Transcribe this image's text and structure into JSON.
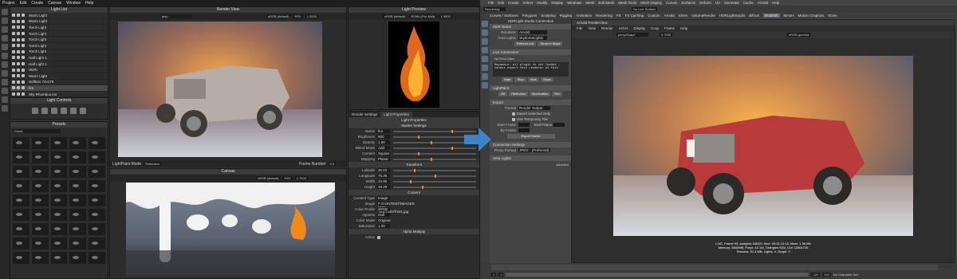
{
  "left": {
    "menu": [
      "Project",
      "Edit",
      "Create",
      "Canvas",
      "Window",
      "Help"
    ],
    "light_list": {
      "title": "Light List",
      "items": [
        "Warm Light",
        "Warm Light",
        "Torch Light",
        "Torch Light",
        "Torch Light",
        "Torch Light",
        "Torch Light",
        "Half Light 1",
        "Half Light 1",
        "HDRi",
        "Warm Light",
        "Softbox 72x175",
        "fire",
        "Sky Rhombus.exr"
      ],
      "selected": 12
    },
    "light_controls": {
      "title": "Light Controls"
    },
    "presets": {
      "title": "Presets",
      "filter": "Cloud"
    },
    "render_view": {
      "title": "Render View",
      "camera": "jeep",
      "color": "sRGB (default)",
      "display": "HSV",
      "value": "1.0000",
      "mode_label": "LightPaint Mode",
      "mode_value": "Reflection",
      "frame_label": "Frame Number",
      "frame_value": "0.0"
    },
    "light_preview": {
      "title": "Light Preview",
      "color": "sRGB (default)",
      "alpha": "RGBA (Pre-Mult)",
      "value": "1.0000"
    },
    "canvas": {
      "title": "Canvas",
      "color": "sRGB (default)",
      "display": "HSV",
      "value": "1.7029"
    },
    "tabs": [
      "Render Settings",
      "Light Properties"
    ],
    "props_title": "Light Properties",
    "master": {
      "title": "Master Settings",
      "rows": [
        {
          "k": "Name",
          "v": "fire"
        },
        {
          "k": "Brightness",
          "v": "900"
        },
        {
          "k": "Opacity",
          "v": "1.00"
        },
        {
          "k": "Blend Mode",
          "v": "Add"
        },
        {
          "k": "Content",
          "v": "Square"
        },
        {
          "k": "Mapping",
          "v": "Planar"
        }
      ],
      "invert": "Invert",
      "preserve": "Preserve Alpha"
    },
    "transform": {
      "title": "Transform",
      "rows": [
        {
          "k": "Latitude",
          "v": "26.03"
        },
        {
          "k": "Longitude",
          "v": "75.36"
        },
        {
          "k": "Width",
          "v": "24.95"
        },
        {
          "k": "Height",
          "v": "48.29"
        }
      ]
    },
    "content": {
      "title": "Content",
      "rows": [
        {
          "k": "Content Type",
          "v": "Image"
        },
        {
          "k": "Image",
          "v": "F:/CONTENT/IMAGES FOR TESTING/Fire1.jpg"
        },
        {
          "k": "Color Profile",
          "v": "sRGB"
        },
        {
          "k": "Options",
          "v": "Half"
        },
        {
          "k": "Color Mode",
          "v": "Original"
        },
        {
          "k": "Saturation",
          "v": "1.00"
        }
      ],
      "change": "Change",
      "flip": "Flip",
      "unpremult": "Unpremultiply",
      "invert_alpha": "Invert Alpha"
    },
    "alpha": {
      "title": "Alpha Multiply",
      "active": "Active"
    }
  },
  "right": {
    "menu": [
      "File",
      "Edit",
      "Create",
      "Select",
      "Modify",
      "Display",
      "Windows",
      "Mesh",
      "Edit Mesh",
      "Mesh Tools",
      "Mesh Display",
      "Curves",
      "Surfaces",
      "Deform",
      "UV",
      "Generate",
      "Cache",
      "Arnold",
      "Help"
    ],
    "workspace": "Rendering",
    "live_surface": "No Live Surface",
    "shelf": [
      "Curves / Surfaces",
      "Polygons",
      "Sculpting",
      "Rigging",
      "Animation",
      "Rendering",
      "FX",
      "FX Caching",
      "Custom",
      "Arnold",
      "XGen",
      "VolumeRender",
      "HDRLightStudio",
      "Bifrost",
      "Redshift",
      "MASH",
      "Motion Graphics",
      "XGen"
    ],
    "shelf_active": 14,
    "ae": {
      "title": "HDRLight Studio Connection",
      "hdr_name": "HDR Name",
      "renderer": "Renderer",
      "renderer_value": "Arnold",
      "area": "Area Lights",
      "sel": "skydomeLight1",
      "refresh": "Refresh List",
      "show": "Show in Maya",
      "live": "Live Connection",
      "no_error": "No Error Data",
      "log": "Mayaware: all plugin is not loaded - cannot export this renderer at this",
      "buttons": [
        "Start",
        "Stop",
        "Hide",
        "Show"
      ],
      "lightpaint": "LightPaint",
      "lp_buttons": [
        "Off",
        "Reflection",
        "Illumination",
        "Rim"
      ],
      "export": "Export",
      "format": "Format",
      "format_value": "Render Output",
      "opt1": "Export Selected Only",
      "opt2": "Use Temporary File",
      "start_frame": "Start Frame",
      "end_frame": "End Frame",
      "by_frame": "By Frame",
      "export_scene": "Export Scene",
      "conn_settings": "Connection Settings",
      "proxy": "Proxy Format",
      "proxy_value": "JPEG - (Preferred)",
      "area_lights": "Area Lights",
      "sel_footer": "selection"
    },
    "arnold": {
      "title": "Arnold RenderView",
      "menus": [
        "File",
        "View",
        "Render",
        "AOVs",
        "Display",
        "Crop",
        "Frame",
        "Help"
      ],
      "camera": "perspShape",
      "zoom": "0.7056",
      "color": "sRGB gamma"
    },
    "stats": [
      "LIVE, Frame 95, samples 3/8/2/0, time: 00:01:12:15, Mem: 1.56 Mb",
      "Memory: 3840MB, Polys: 42.1M, Triangles 91M, Out: 1280x720",
      "Textures: 91.4 MB, Lights: 4, Graph: 0"
    ],
    "timeline": {
      "start": "1",
      "end": "120",
      "start2": "1",
      "end2": "200",
      "no_char": "No Character Set"
    }
  }
}
